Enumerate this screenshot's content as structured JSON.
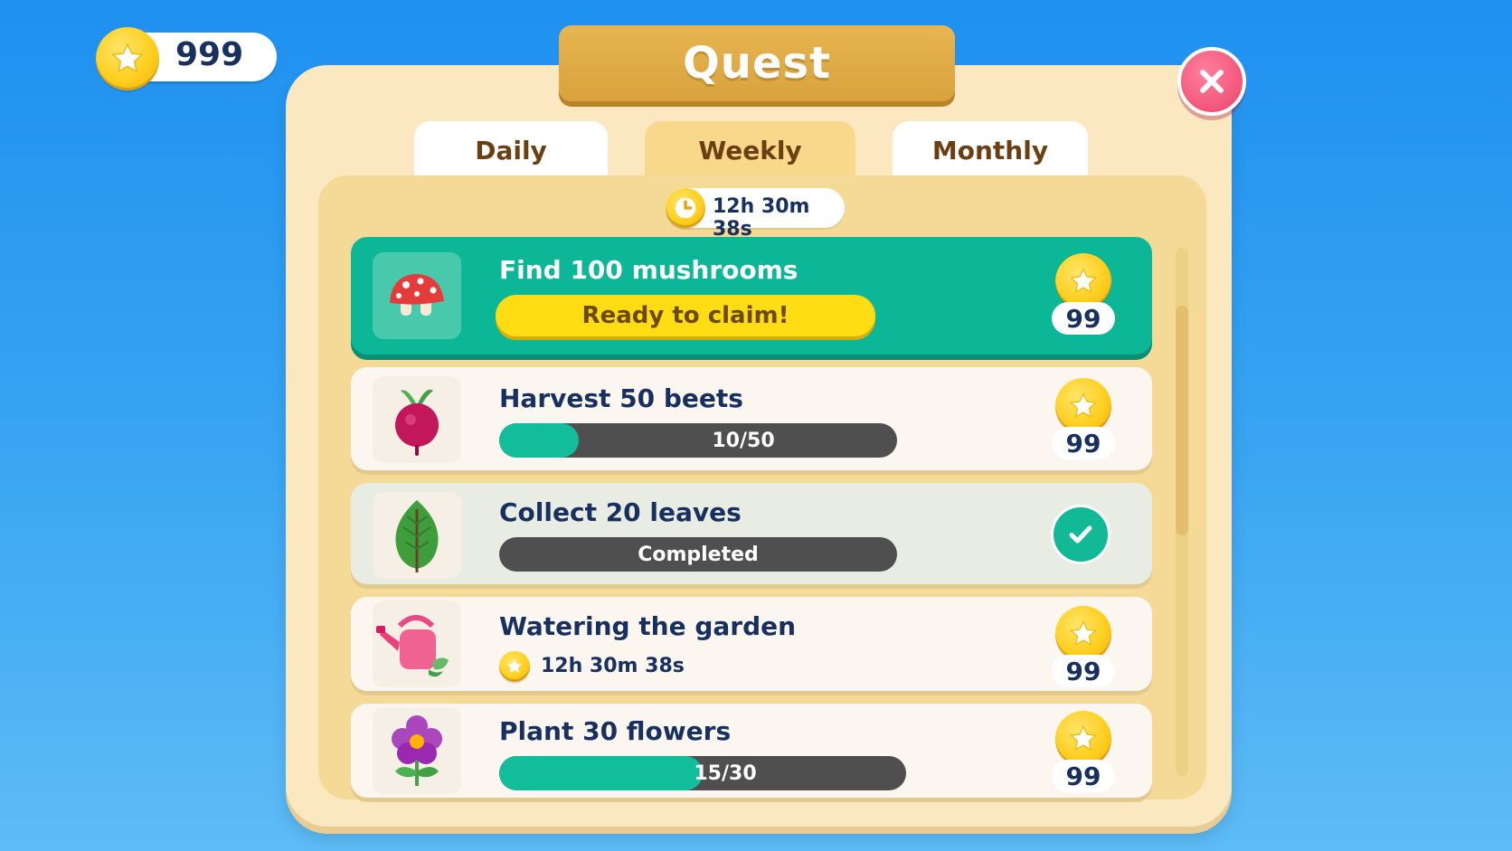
{
  "currency": {
    "amount": "999",
    "icon": "star-coin-icon"
  },
  "panel": {
    "title": "Quest",
    "close_icon": "close-x-icon"
  },
  "tabs": [
    {
      "label": "Daily",
      "active": false
    },
    {
      "label": "Weekly",
      "active": true
    },
    {
      "label": "Monthly",
      "active": false
    }
  ],
  "timer": {
    "text": "12h 30m 38s",
    "icon": "clock-icon"
  },
  "quests": [
    {
      "title": "Find 100 mushrooms",
      "icon": "mushroom-icon",
      "status": "claimable",
      "action_label": "Ready to claim!",
      "reward": "99"
    },
    {
      "title": "Harvest 50 beets",
      "icon": "beet-icon",
      "status": "in-progress",
      "progress_label": "10/50",
      "progress": 0.2,
      "reward": "99"
    },
    {
      "title": "Collect 20 leaves",
      "icon": "leaf-icon",
      "status": "completed",
      "progress_label": "Completed",
      "progress": 1.0
    },
    {
      "title": "Watering the garden",
      "icon": "watering-can-icon",
      "status": "timed",
      "timer_text": "12h 30m 38s",
      "reward": "99"
    },
    {
      "title": "Plant 30 flowers",
      "icon": "flower-icon",
      "status": "in-progress",
      "progress_label": "15/30",
      "progress": 0.5,
      "reward": "99"
    }
  ],
  "colors": {
    "accent_green": "#0bb796",
    "claim_yellow": "#ffdc14",
    "close_pink": "#f2557a",
    "title_gold": "#d9a23b"
  }
}
